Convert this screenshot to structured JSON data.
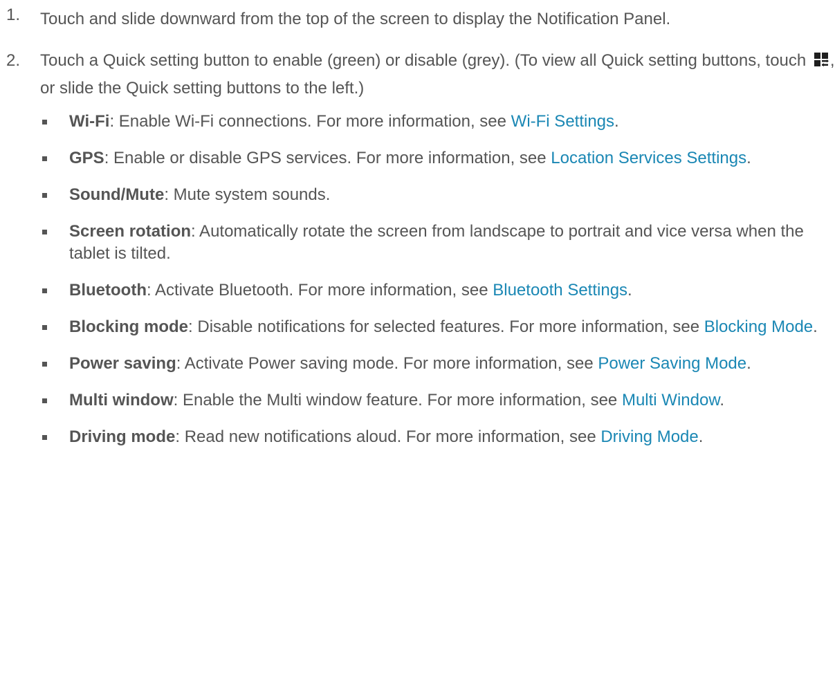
{
  "steps": [
    {
      "number": "1.",
      "text": "Touch and slide downward from the top of the screen to display the Notification Panel."
    },
    {
      "number": "2.",
      "text_before_icon": "Touch a Quick setting button to enable (green) or disable (grey). (To view all Quick setting buttons, touch ",
      "icon": "quick-settings-grid-icon",
      "text_after_icon": ", or slide the Quick setting buttons to the left.)"
    }
  ],
  "options": [
    {
      "name": "Wi-Fi",
      "description": ": Enable Wi-Fi connections. For more information, see ",
      "link": "Wi-Fi Settings",
      "end": "."
    },
    {
      "name": "GPS",
      "description": ": Enable or disable GPS services. For more information, see ",
      "link": "Location Services Settings",
      "end": "."
    },
    {
      "name": "Sound/Mute",
      "description": ": Mute system sounds.",
      "link": "",
      "end": ""
    },
    {
      "name": "Screen rotation",
      "description": ": Automatically rotate the screen from landscape to portrait and vice versa when the tablet is tilted.",
      "link": "",
      "end": ""
    },
    {
      "name": "Bluetooth",
      "description": ": Activate Bluetooth. For more information, see ",
      "link": "Bluetooth Settings",
      "end": "."
    },
    {
      "name": "Blocking mode",
      "description": ": Disable notifications for selected features. For more information, see ",
      "link": "Blocking Mode",
      "end": "."
    },
    {
      "name": "Power saving",
      "description": ": Activate Power saving mode. For more information, see ",
      "link": "Power Saving Mode",
      "end": "."
    },
    {
      "name": "Multi window",
      "description": ": Enable the Multi window feature. For more information, see ",
      "link": "Multi Window",
      "end": "."
    },
    {
      "name": "Driving mode",
      "description": ": Read new notifications aloud. For more information, see ",
      "link": "Driving Mode",
      "end": "."
    }
  ],
  "colors": {
    "text": "#555555",
    "link": "#1a87b4",
    "bullet": "#555555"
  }
}
